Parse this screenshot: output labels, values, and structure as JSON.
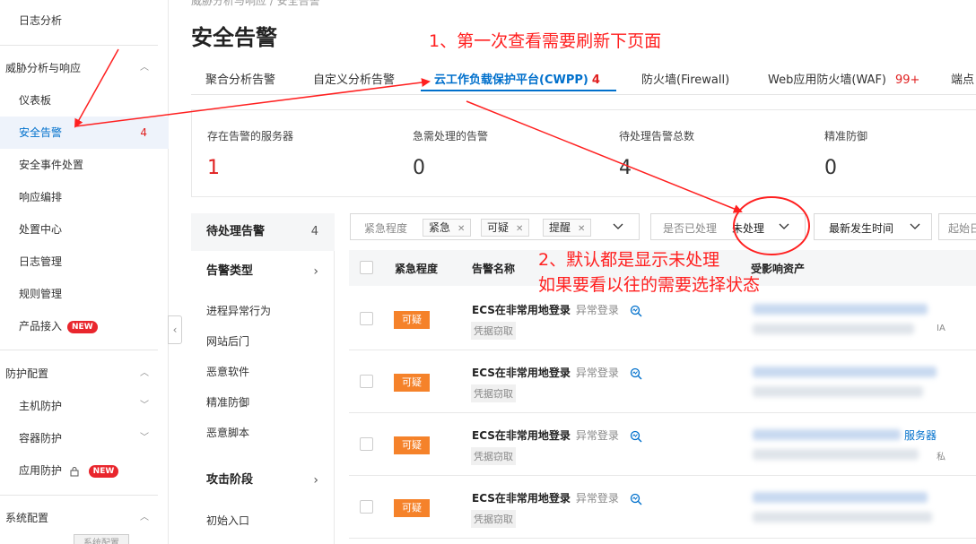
{
  "sidebar": {
    "top_item": "日志分析",
    "group_threat": "威胁分析与响应",
    "items": [
      {
        "label": "仪表板"
      },
      {
        "label": "安全告警",
        "count": "4"
      },
      {
        "label": "安全事件处置"
      },
      {
        "label": "响应编排"
      },
      {
        "label": "处置中心"
      },
      {
        "label": "日志管理"
      },
      {
        "label": "规则管理"
      },
      {
        "label": "产品接入",
        "badge": "NEW"
      }
    ],
    "group_protection": "防护配置",
    "protection_items": [
      {
        "label": "主机防护"
      },
      {
        "label": "容器防护"
      },
      {
        "label": "应用防护",
        "badge": "NEW"
      }
    ],
    "group_system": "系统配置",
    "system_tag": "系统配置"
  },
  "page": {
    "breadcrumb": "威胁分析与响应 / 安全告警",
    "title": "安全告警"
  },
  "tabs": [
    {
      "label": "聚合分析告警"
    },
    {
      "label": "自定义分析告警"
    },
    {
      "label": "云工作负载保护平台(CWPP)",
      "count": "4"
    },
    {
      "label": "防火墙(Firewall)"
    },
    {
      "label": "Web应用防火墙(WAF)",
      "count": "99+"
    },
    {
      "label": "端点"
    }
  ],
  "stats": [
    {
      "label": "存在告警的服务器",
      "value": "1"
    },
    {
      "label": "急需处理的告警",
      "value": "0"
    },
    {
      "label": "待处理告警总数",
      "value": "4"
    },
    {
      "label": "精准防御",
      "value": "0"
    }
  ],
  "filter_panel": {
    "pending": {
      "label": "待处理告警",
      "count": "4"
    },
    "type_header": "告警类型",
    "types": [
      "进程异常行为",
      "网站后门",
      "恶意软件",
      "精准防御",
      "恶意脚本"
    ],
    "stage_header": "攻击阶段",
    "stages": [
      "初始入口"
    ]
  },
  "filters": {
    "urgency_label": "紧急程度",
    "urgency_chips": [
      "紧急",
      "可疑",
      "提醒"
    ],
    "handled_label": "是否已处理",
    "handled_value": "未处理",
    "sort_value": "最新发生时间",
    "start_label": "起始日"
  },
  "table": {
    "headers": {
      "urgency": "紧急程度",
      "name": "告警名称",
      "asset": "受影响资产"
    },
    "rows": [
      {
        "urgency": "可疑",
        "name": "ECS在非常用地登录",
        "sub": "异常登录",
        "category": "凭据窃取",
        "asset_text": "",
        "asset_small": "IA"
      },
      {
        "urgency": "可疑",
        "name": "ECS在非常用地登录",
        "sub": "异常登录",
        "category": "凭据窃取",
        "asset_text": "",
        "asset_small": ""
      },
      {
        "urgency": "可疑",
        "name": "ECS在非常用地登录",
        "sub": "异常登录",
        "category": "凭据窃取",
        "asset_text": "服务器",
        "asset_small": "私"
      },
      {
        "urgency": "可疑",
        "name": "ECS在非常用地登录",
        "sub": "异常登录",
        "category": "凭据窃取",
        "asset_text": "",
        "asset_small": ""
      }
    ]
  },
  "annotations": {
    "note1": "1、第一次查看需要刷新下页面",
    "note2_line1": "2、默认都是显示未处理",
    "note2_line2": "如果要看以往的需要选择状态"
  },
  "colors": {
    "accent": "#0070cc",
    "danger": "#e02020",
    "suspect": "#f5822a",
    "annotation": "#ff2020"
  }
}
